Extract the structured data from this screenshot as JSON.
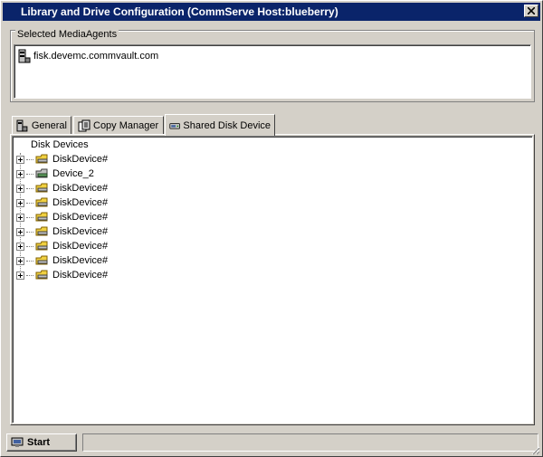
{
  "window": {
    "title": "Library and Drive Configuration (CommServe Host:blueberry)"
  },
  "media_agents": {
    "group_label": "Selected MediaAgents",
    "items": [
      {
        "name": "fisk.devemc.commvault.com",
        "icon": "server-icon"
      }
    ]
  },
  "tabs": [
    {
      "label": "General",
      "icon": "server-icon",
      "active": false
    },
    {
      "label": "Copy Manager",
      "icon": "copy-manager-icon",
      "active": false
    },
    {
      "label": "Shared Disk Device",
      "icon": "shared-disk-icon",
      "active": true
    }
  ],
  "tree": {
    "root_label": "Disk Devices",
    "nodes": [
      {
        "label": "DiskDevice#",
        "icon": "disk-device-icon"
      },
      {
        "label": "Device_2",
        "icon": "disk-device-alt-icon"
      },
      {
        "label": "DiskDevice#",
        "icon": "disk-device-icon"
      },
      {
        "label": "DiskDevice#",
        "icon": "disk-device-icon"
      },
      {
        "label": "DiskDevice#",
        "icon": "disk-device-icon"
      },
      {
        "label": "DiskDevice#",
        "icon": "disk-device-icon"
      },
      {
        "label": "DiskDevice#",
        "icon": "disk-device-icon"
      },
      {
        "label": "DiskDevice#",
        "icon": "disk-device-icon"
      },
      {
        "label": "DiskDevice#",
        "icon": "disk-device-icon"
      }
    ]
  },
  "statusbar": {
    "start_label": "Start",
    "status_text": ""
  },
  "colors": {
    "titlebar": "#0a246a",
    "face": "#d4d0c8",
    "folder_yellow": "#f0d040"
  }
}
